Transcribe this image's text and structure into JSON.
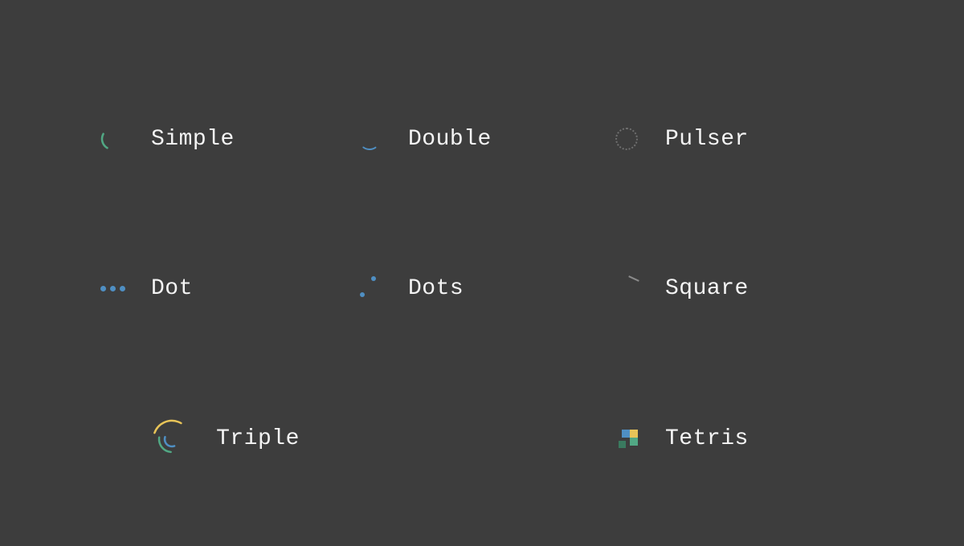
{
  "spinners": {
    "simple": {
      "label": "Simple",
      "icon": "simple-spinner-icon"
    },
    "double": {
      "label": "Double",
      "icon": "double-spinner-icon"
    },
    "pulser": {
      "label": "Pulser",
      "icon": "pulser-spinner-icon"
    },
    "dot": {
      "label": "Dot",
      "icon": "dot-spinner-icon"
    },
    "dots": {
      "label": "Dots",
      "icon": "dots-spinner-icon"
    },
    "square": {
      "label": "Square",
      "icon": "square-spinner-icon"
    },
    "triple": {
      "label": "Triple",
      "icon": "triple-spinner-icon"
    },
    "tetris": {
      "label": "Tetris",
      "icon": "tetris-spinner-icon"
    }
  },
  "colors": {
    "background": "#3d3d3d",
    "foreground": "#f4f4f4",
    "green": "#51a884",
    "blue": "#4f8fc3",
    "yellow": "#e8c458"
  }
}
